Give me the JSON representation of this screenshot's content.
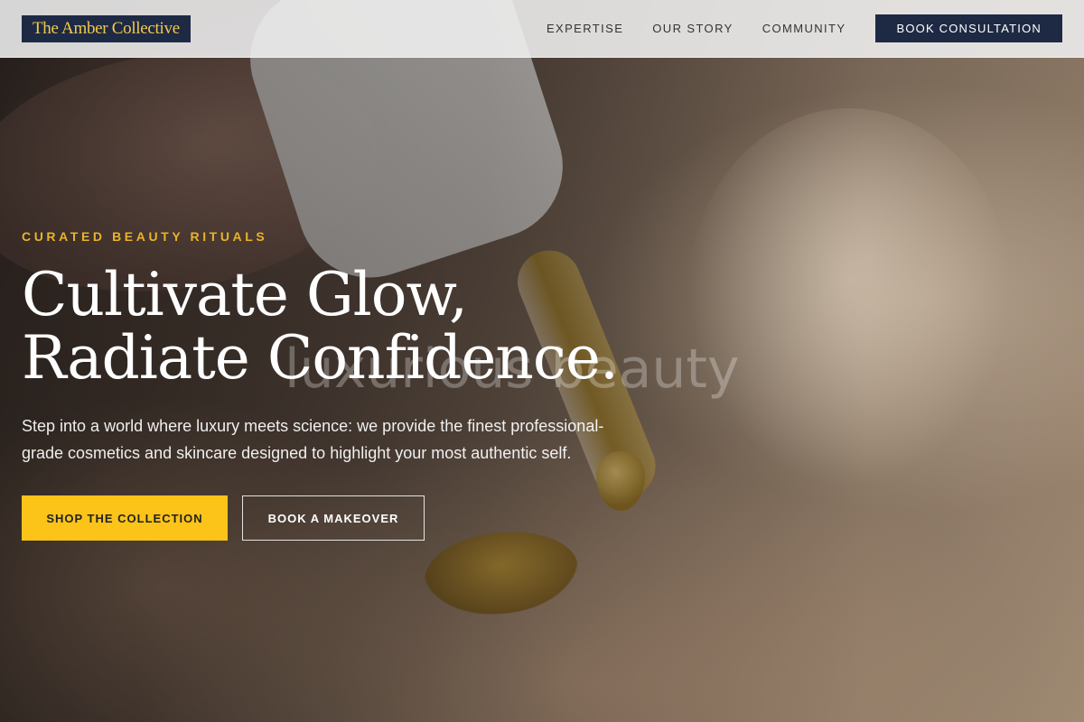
{
  "header": {
    "brand": "The Amber Collective",
    "nav": [
      "EXPERTISE",
      "OUR STORY",
      "COMMUNITY"
    ],
    "cta": "BOOK CONSULTATION"
  },
  "hero": {
    "eyebrow": "CURATED BEAUTY RITUALS",
    "headline_line1": "Cultivate Glow,",
    "headline_line2": "Radiate Confidence.",
    "description": "Step into a world where luxury meets science: we provide the finest professional-grade cosmetics and skincare designed to highlight your most authentic self.",
    "primary_button": "SHOP THE COLLECTION",
    "secondary_button": "BOOK A MAKEOVER",
    "background_watermark": "luxurious beauty"
  },
  "colors": {
    "accent": "#fcc419",
    "brand_navy": "#1e2a44",
    "eyebrow": "#e8b429"
  }
}
